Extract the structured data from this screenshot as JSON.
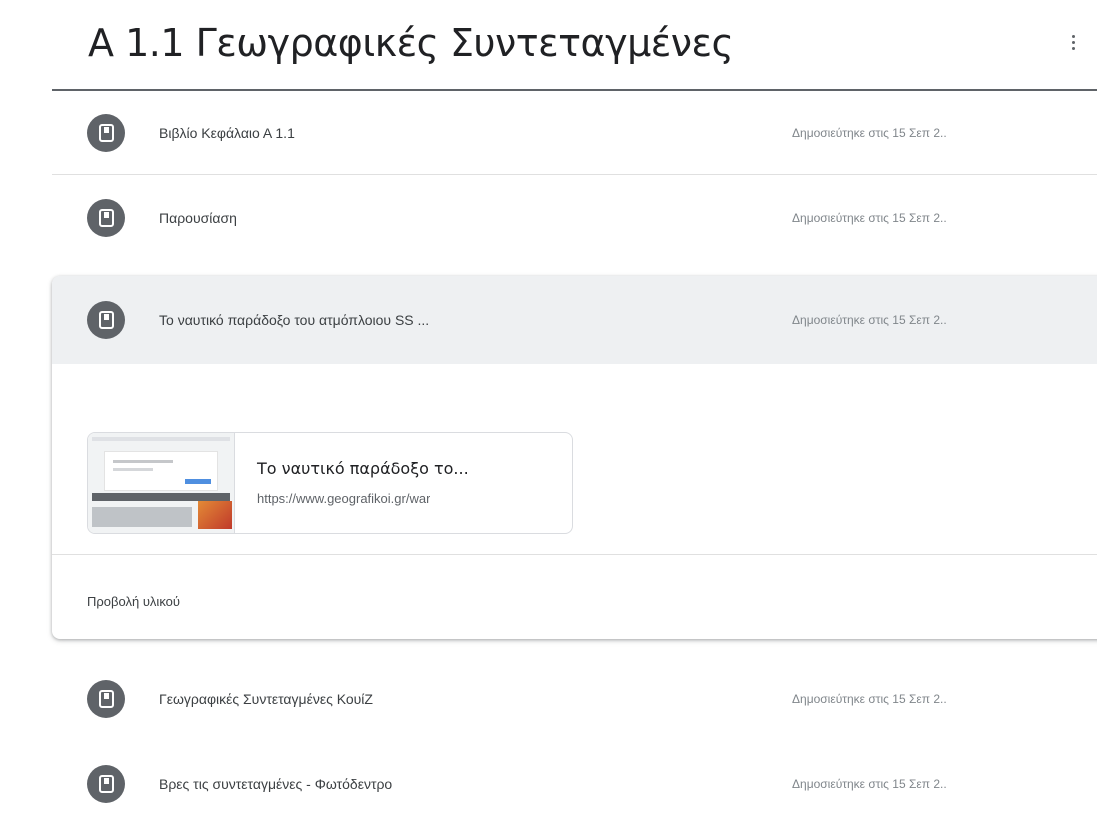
{
  "topic": {
    "title": "A 1.1 Γεωγραφικές Συντεταγμένες"
  },
  "materials": [
    {
      "title": "Βιβλίο Κεφάλαιο Α 1.1",
      "date": "Δημοσιεύτηκε στις 15 Σεπ 2..",
      "icon": "material-icon"
    },
    {
      "title": "Παρουσίαση",
      "date": "Δημοσιεύτηκε στις 15 Σεπ 2..",
      "icon": "material-icon"
    },
    {
      "title": "Το ναυτικό παράδοξο του ατμόπλοιου SS ...",
      "date": "Δημοσιεύτηκε στις 15 Σεπ 2..",
      "icon": "material-icon"
    },
    {
      "title": "Γεωγραφικές Συντεταγμένες ΚουίΖ",
      "date": "Δημοσιεύτηκε στις 15 Σεπ 2..",
      "icon": "material-icon"
    },
    {
      "title": "Βρες τις συντεταγμένες - Φωτόδεντρο",
      "date": "Δημοσιεύτηκε στις 15 Σεπ 2..",
      "icon": "material-icon"
    }
  ],
  "expanded": {
    "attachment": {
      "title": "Το ναυτικό παράδοξο το...",
      "url": "https://www.geografikoi.gr/war"
    },
    "view_label": "Προβολή υλικού"
  },
  "colors": {
    "accent": "#5f6368",
    "highlight": "#eef0f2"
  }
}
